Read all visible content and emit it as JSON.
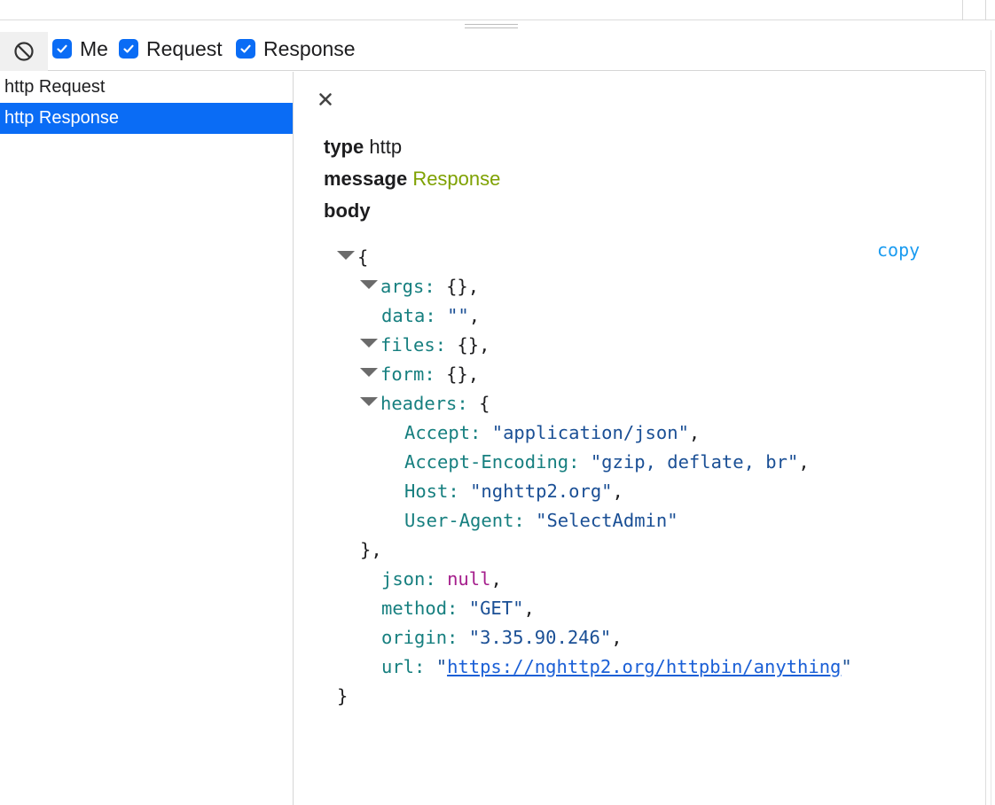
{
  "toolbar": {
    "filters": [
      {
        "label": "Me",
        "checked": true
      },
      {
        "label": "Request",
        "checked": true
      },
      {
        "label": "Response",
        "checked": true
      }
    ]
  },
  "list": {
    "items": [
      {
        "label": "http Request",
        "selected": false
      },
      {
        "label": "http Response",
        "selected": true
      }
    ]
  },
  "detail": {
    "type_key": "type",
    "type_value": "http",
    "message_key": "message",
    "message_value": "Response",
    "body_key": "body",
    "copy_label": "copy"
  },
  "json": {
    "open_brace": "{",
    "args_key": "args:",
    "args_val": "{},",
    "data_key": "data:",
    "data_val": "\"\"",
    "data_comma": ",",
    "files_key": "files:",
    "files_val": "{},",
    "form_key": "form:",
    "form_val": "{},",
    "headers_key": "headers:",
    "headers_open": "{",
    "h_accept_key": "Accept:",
    "h_accept_val": "\"application/json\"",
    "h_accept_enc_key": "Accept-Encoding:",
    "h_accept_enc_val": "\"gzip, deflate, br\"",
    "h_host_key": "Host:",
    "h_host_val": "\"nghttp2.org\"",
    "h_ua_key": "User-Agent:",
    "h_ua_val": "\"SelectAdmin\"",
    "headers_close": "},",
    "json_key": "json:",
    "json_val": "null",
    "method_key": "method:",
    "method_val": "\"GET\"",
    "origin_key": "origin:",
    "origin_val": "\"3.35.90.246\"",
    "url_key": "url:",
    "url_quote": "\"",
    "url_val": "https://nghttp2.org/httpbin/anything",
    "close_brace": "}",
    "comma": ","
  },
  "colors": {
    "accent": "#0a6cf5",
    "json_key": "#167f7f",
    "json_string": "#1a4f95",
    "json_null": "#a51e8c",
    "message_value": "#7ea100",
    "copy": "#1a9bf0"
  },
  "icons": {
    "clear": "block-icon",
    "close": "close-icon",
    "check": "checkmark-icon",
    "expand": "triangle-down-icon"
  }
}
